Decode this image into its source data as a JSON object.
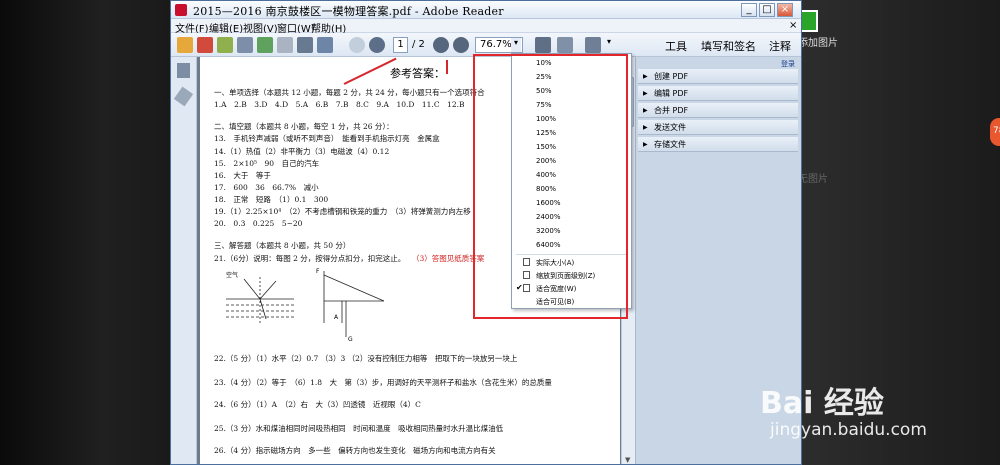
{
  "window": {
    "title": "2015—2016 南京鼓楼区一模物理答案.pdf - Adobe Reader"
  },
  "menu": [
    "文件(F)",
    "编辑(E)",
    "视图(V)",
    "窗口(W)",
    "帮助(H)"
  ],
  "toolbar": {
    "page_current": "1",
    "page_total": "/ 2",
    "zoom": "76.7%",
    "tools_label": "工具",
    "sign_label": "填写和签名",
    "comment_label": "注释"
  },
  "zoom_menu": {
    "levels": [
      "10%",
      "25%",
      "50%",
      "75%",
      "100%",
      "125%",
      "150%",
      "200%",
      "400%",
      "800%",
      "1600%",
      "2400%",
      "3200%",
      "6400%"
    ],
    "fit_options": [
      "实际大小(A)",
      "缩放到页面级别(Z)",
      "适合宽度(W)",
      "适合可见(B)"
    ],
    "checked_option": "适合宽度(W)"
  },
  "right_panel": {
    "login": "登录",
    "sections": [
      "创建 PDF",
      "编辑 PDF",
      "合并 PDF",
      "发送文件",
      "存储文件"
    ]
  },
  "document": {
    "title": "参考答案：",
    "lines": [
      "一、单项选择（本题共 12 小题，每题 2 分，共 24 分，每小题只有一个选项符合",
      "1.A　2.B　3.D　4.D　5.A　6.B　7.B　8.C　9.A　10.D　11.C　12.B",
      "二、填空题（本题共 8 小题，每空 1 分，共 26 分）：",
      "13.　手机铃声减弱（或听不到声音）　能看到手机指示灯亮　金属盒",
      "14.（1）热值（2）非平衡力（3）电磁波（4）0.12",
      "15.　2×10⁵　90　自己的汽车",
      "16.　大于　等于",
      "17.　600　36　66.7%　减小",
      "18.　正常　短路　（1）0.1　300",
      "19.（1）2.25×10⁴　（2）不考虑槽钢和铁笼的重力　（3）将弹簧测力向左移",
      "20.　0.3　0.225　5~20",
      "三、解答题（本题共 8 小题，共 50 分）",
      "21.（6分）说明：每图 2 分，按得分点扣分，扣完这止。",
      "22.（5 分）（1）水平（2）0.7 （3）3 （2）没有控制压力相等　把取下的一块放另一块上",
      "23.（4 分）（2）等于　（6）1.8　大　第（3）步，用调好的天平测杯子和盐水（含花生米）的总质量",
      "24.（6 分）（1）A　（2）右　大（3）凹透镜　近视眼（4）C",
      "25.（3 分）水和煤油相同时间吸热相同　时间和温度　吸收相同热量时水升温比煤油低",
      "26.（4 分）指示磁场方向　多一些　偏转方向也发生变化　磁场方向和电流方向有关"
    ],
    "red_note": "（3）答图见纸质答案",
    "figure_labels": [
      "空气",
      "F",
      "A",
      "G"
    ]
  },
  "watermark": {
    "brand": "Bai 经验",
    "url": "jingyan.baidu.com"
  },
  "background": {
    "add_image": "添加图片",
    "no_image": "无图片",
    "badge": "78"
  },
  "colors": {
    "highlight_box": "#e3262b",
    "red_text": "#d01e1e",
    "window_bg": "#d7e4f2"
  }
}
